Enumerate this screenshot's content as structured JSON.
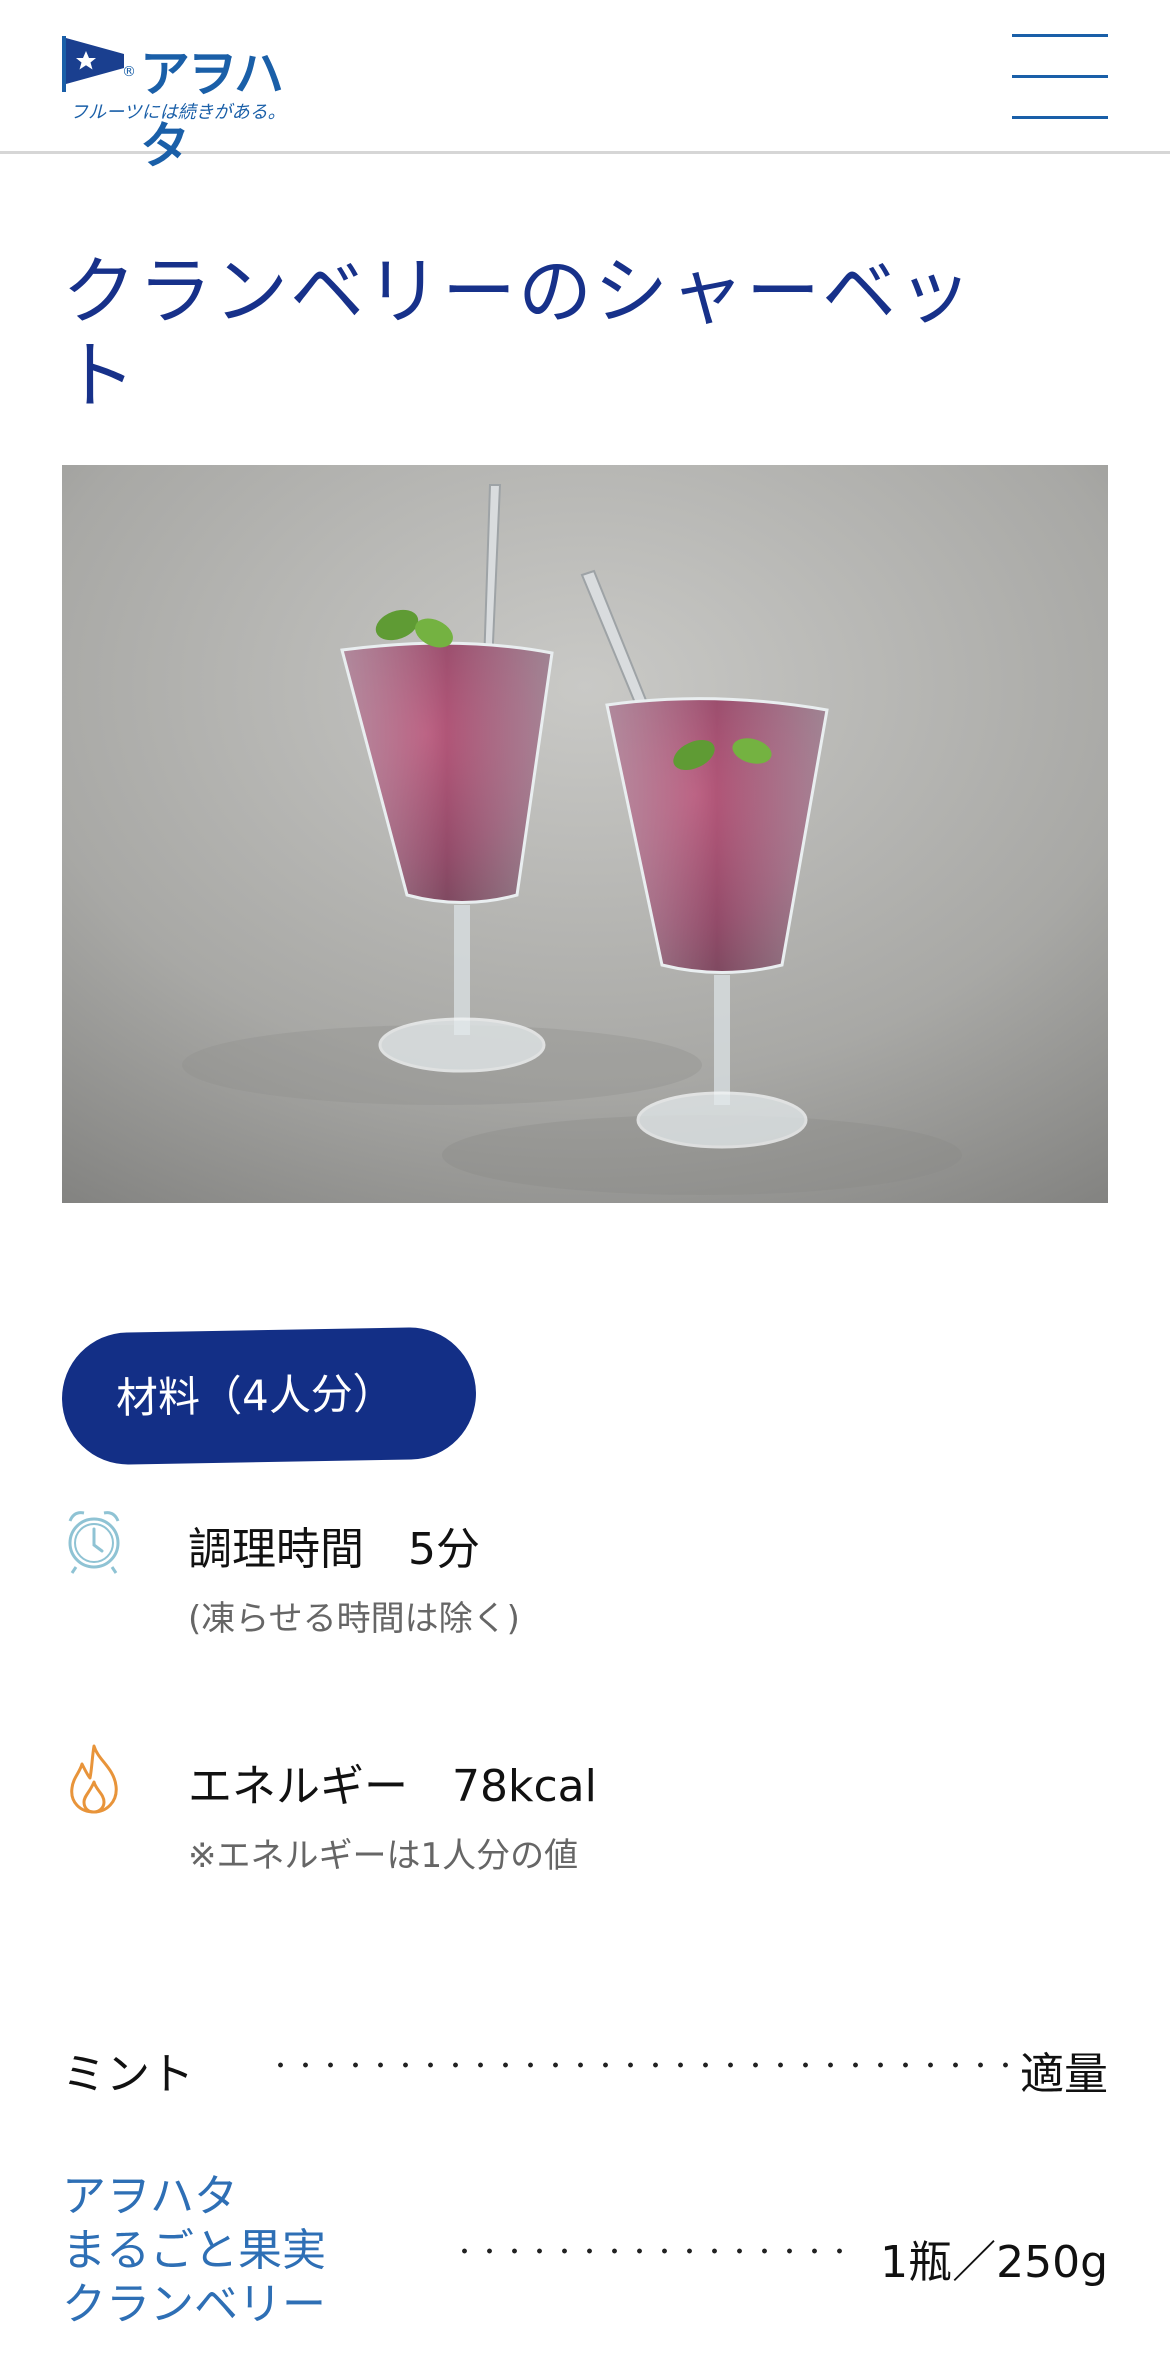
{
  "header": {
    "logo_name": "アヲハタ",
    "logo_reg": "®",
    "tagline": "フルーツには続きがある。",
    "menu_icon": "hamburger-menu-icon"
  },
  "recipe": {
    "title_line1": "クランベリーのシャーベッ",
    "title_line2": "ト",
    "image_alt": "クランベリーのシャーベット"
  },
  "servings": {
    "label": "材料（4人分）"
  },
  "info": {
    "time": {
      "icon": "alarm-clock-icon",
      "label": "調理時間　5分",
      "note": "(凍らせる時間は除く)"
    },
    "energy": {
      "icon": "flame-icon",
      "label": "エネルギー　78kcal",
      "note": "※エネルギーは1人分の値"
    }
  },
  "ingredients": [
    {
      "name": "ミント",
      "quantity": "適量"
    },
    {
      "name_lines": [
        "アヲハタ",
        "まるごと果実",
        "クランベリー"
      ],
      "quantity": "1瓶／250g"
    }
  ],
  "colors": {
    "brand_blue": "#1a5fa8",
    "title_navy": "#17318a",
    "pill_navy": "#132f86",
    "link_blue": "#2e6fb5",
    "clock_icon": "#8fc3d4",
    "flame_icon": "#e8943a"
  }
}
